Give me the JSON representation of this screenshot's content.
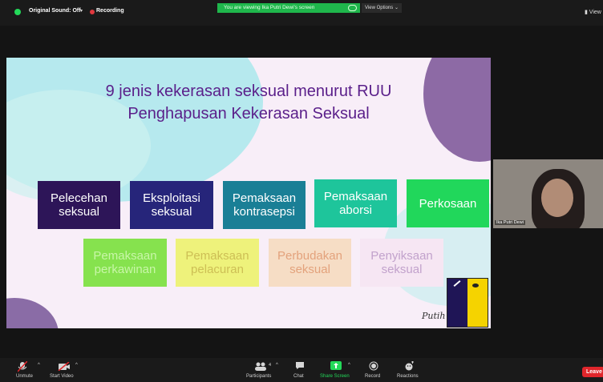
{
  "top_bar": {
    "original_sound": "Original Sound: Off",
    "original_sound_caret": "▾",
    "recording": "Recording",
    "viewing_banner": "You are viewing Ika Putri Dewi's screen",
    "view_options": "View Options ⌄",
    "view_right": "▮ View"
  },
  "slide": {
    "title_line1": "9 jenis kekerasan seksual menurut RUU",
    "title_line2": "Penghapusan Kekerasan Seksual",
    "boxes_row1": [
      {
        "text": "Pelecehan seksual",
        "color": "#2d1558"
      },
      {
        "text": "Eksploitasi seksual",
        "color": "#26257a"
      },
      {
        "text": "Pemaksaan kontrasepsi",
        "color": "#1a7f96"
      },
      {
        "text": "Pemaksaan aborsi",
        "color": "#1ec59b"
      },
      {
        "text": "Perkosaan",
        "color": "#21d75b"
      }
    ],
    "boxes_row2": [
      {
        "text": "Pemaksaan perkawinan",
        "color": "#86e24e"
      },
      {
        "text": "Pemaksaan pelacuran",
        "color": "#eef27b"
      },
      {
        "text": "Perbudakan seksual",
        "color": "#f6ddc5"
      },
      {
        "text": "Penyiksaan seksual",
        "color": "#f6e6f3"
      }
    ],
    "signature": "Putih"
  },
  "participant": {
    "name": "Ika Putri Dewi"
  },
  "toolbar": {
    "unmute": "Unmute",
    "start_video": "Start Video",
    "participants": "Participants",
    "participants_count": "4",
    "chat": "Chat",
    "share_screen": "Share Screen",
    "record": "Record",
    "reactions": "Reactions",
    "leave": "Leave"
  },
  "colors": {
    "share_green": "#23d959",
    "leave_red": "#e0262b",
    "title_purple": "#5a1f8a"
  }
}
